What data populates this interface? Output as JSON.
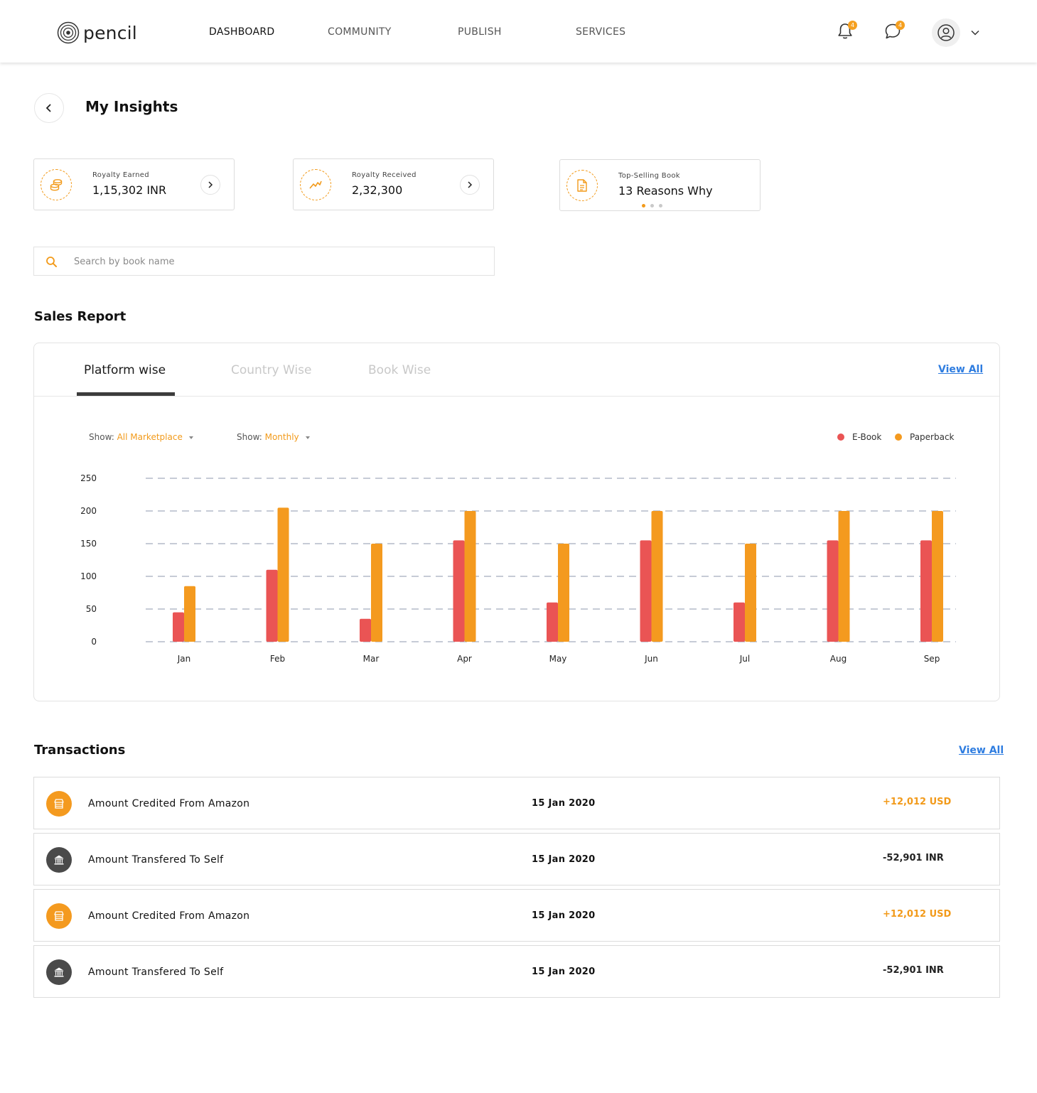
{
  "header": {
    "logo_text": "pencil",
    "nav": [
      "DASHBOARD",
      "COMMUNITY",
      "PUBLISH",
      "SERVICES"
    ],
    "notifications_count": "4",
    "messages_count": "4"
  },
  "page": {
    "title": "My Insights"
  },
  "stats": [
    {
      "label": "Royalty Earned",
      "value": "1,15,302 INR",
      "icon": "coins-icon"
    },
    {
      "label": "Royalty Received",
      "value": "2,32,300",
      "icon": "trend-chart-icon"
    },
    {
      "label": "Top-Selling Book",
      "value": "13 Reasons Why",
      "icon": "book-file-icon"
    }
  ],
  "search": {
    "placeholder": "Search by book name"
  },
  "sales_report": {
    "title": "Sales Report",
    "tabs": [
      "Platform wise",
      "Country Wise",
      "Book Wise"
    ],
    "active_tab": "Platform wise",
    "view_all": "View All",
    "filters": [
      {
        "label": "Show:",
        "value": "All Marketplace"
      },
      {
        "label": "Show:",
        "value": "Monthly"
      }
    ]
  },
  "colors": {
    "accent": "#f29a1a",
    "ebook": "#ea5454",
    "paperback": "#f49a1f",
    "link": "#2f7de0",
    "dark_icon": "#4a4a4a"
  },
  "chart_data": {
    "type": "bar",
    "categories": [
      "Jan",
      "Feb",
      "Mar",
      "Apr",
      "May",
      "Jun",
      "Jul",
      "Aug",
      "Sep"
    ],
    "series": [
      {
        "name": "E-Book",
        "values": [
          45,
          110,
          35,
          155,
          60,
          155,
          60,
          155,
          155
        ]
      },
      {
        "name": "Paperback",
        "values": [
          85,
          205,
          150,
          200,
          150,
          200,
          150,
          200,
          200
        ]
      }
    ],
    "yticks": [
      0,
      50,
      100,
      150,
      200,
      250
    ],
    "ylim": [
      0,
      250
    ],
    "grid": true,
    "legend_position": "top-right"
  },
  "transactions": {
    "title": "Transactions",
    "view_all": "View All",
    "items": [
      {
        "desc": "Amount Credited From Amazon",
        "date": "15 Jan 2020",
        "amount": "+12,012 USD",
        "kind": "credit",
        "icon": "store-icon"
      },
      {
        "desc": "Amount Transfered To Self",
        "date": "15 Jan 2020",
        "amount": "-52,901 INR",
        "kind": "debit",
        "icon": "bank-icon"
      },
      {
        "desc": "Amount Credited From Amazon",
        "date": "15 Jan 2020",
        "amount": "+12,012 USD",
        "kind": "credit",
        "icon": "store-icon"
      },
      {
        "desc": "Amount Transfered To Self",
        "date": "15 Jan 2020",
        "amount": "-52,901 INR",
        "kind": "debit",
        "icon": "bank-icon"
      }
    ]
  }
}
